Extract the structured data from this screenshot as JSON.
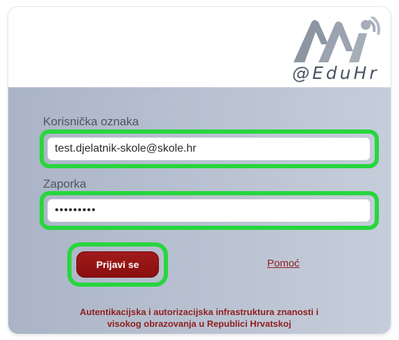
{
  "logo": {
    "text": "@EduHr",
    "icon": "aai-logo-icon"
  },
  "form": {
    "username_label": "Korisnička oznaka",
    "username_value": "test.djelatnik-skole@skole.hr",
    "password_label": "Zaporka",
    "password_value": "•••••••••",
    "login_button": "Prijavi se",
    "help_link": "Pomoć"
  },
  "footer": {
    "line1": "Autentikacijska i autorizacijska infrastruktura znanosti i",
    "line2": "visokog obrazovanja u Republici Hrvatskoj"
  },
  "colors": {
    "highlight": "#27d63d",
    "button": "#9a1616",
    "link": "#8f1f1f"
  }
}
